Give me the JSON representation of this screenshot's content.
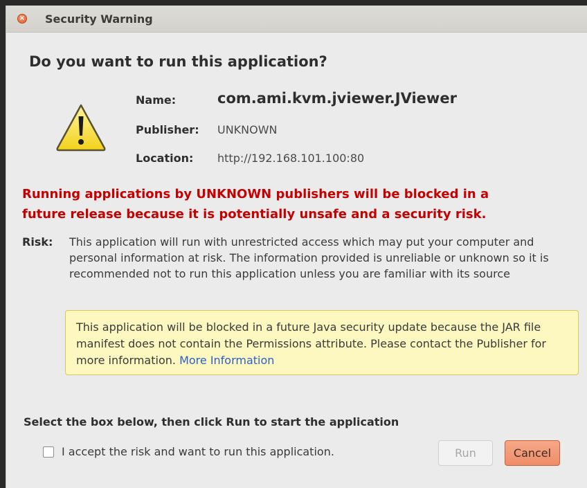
{
  "window": {
    "title": "Security Warning",
    "close_glyph": "×"
  },
  "dialog": {
    "heading": "Do you want to run this application?",
    "icon": "warning-triangle-icon",
    "fields": {
      "name_label": "Name:",
      "name_value": "com.ami.kvm.jviewer.JViewer",
      "publisher_label": "Publisher:",
      "publisher_value": "UNKNOWN",
      "location_label": "Location:",
      "location_value": "http://192.168.101.100:80"
    },
    "red_warning_line1": "Running applications by UNKNOWN publishers will be blocked in a",
    "red_warning_line2": "future release because it is potentially unsafe and a security risk.",
    "risk_label": "Risk:",
    "risk_text": "This application will run with unrestricted access which may put your computer and personal information at risk. The information provided is unreliable or unknown so it is recommended not to run this application unless you are familiar with its source",
    "info_box": {
      "text": "This application will be blocked in a future Java security update because the JAR file manifest does not contain the Permissions attribute. Please contact the Publisher for more information.",
      "link": "More Information"
    },
    "instruction": "Select the box below, then click Run to start the application",
    "checkbox_label": "I accept the risk and want to run this application.",
    "checkbox_checked": false,
    "run_label": "Run",
    "cancel_label": "Cancel"
  },
  "colors": {
    "warning_red": "#c40000",
    "link_blue": "#2d5fc7",
    "info_bg": "#fcf8bf",
    "cancel_bg": "#ee8d67"
  }
}
